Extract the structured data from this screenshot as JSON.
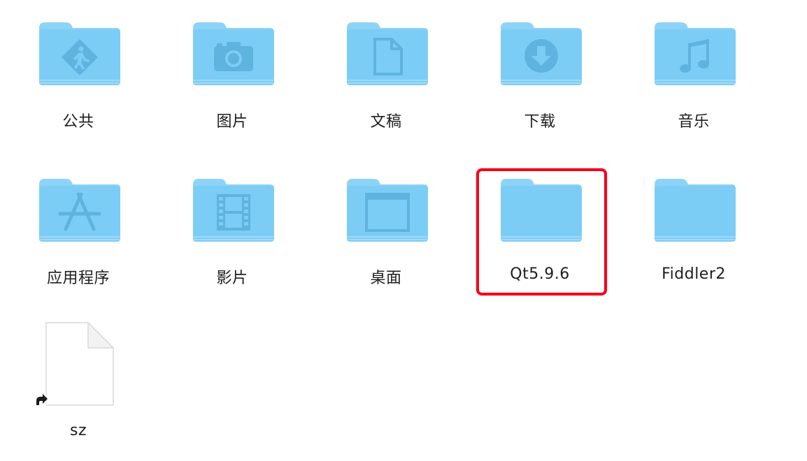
{
  "accent_color": "#7acbf5",
  "folder_color": "#78c7f2",
  "highlight_color": "#f5001b",
  "items": [
    {
      "label": "公共",
      "icon": "public-walker-icon",
      "selected": false
    },
    {
      "label": "图片",
      "icon": "camera-icon",
      "selected": false
    },
    {
      "label": "文稿",
      "icon": "document-icon",
      "selected": false
    },
    {
      "label": "下载",
      "icon": "download-arrow-icon",
      "selected": false
    },
    {
      "label": "音乐",
      "icon": "music-note-icon",
      "selected": false
    },
    {
      "label": "应用程序",
      "icon": "app-store-a-icon",
      "selected": false
    },
    {
      "label": "影片",
      "icon": "film-strip-icon",
      "selected": false
    },
    {
      "label": "桌面",
      "icon": "desktop-window-icon",
      "selected": false
    },
    {
      "label": "Qt5.9.6",
      "icon": "plain-folder-icon",
      "selected": true
    },
    {
      "label": "Fiddler2",
      "icon": "plain-folder-icon",
      "selected": false
    },
    {
      "label": "sz",
      "icon": "alias-file-icon",
      "selected": false
    }
  ]
}
